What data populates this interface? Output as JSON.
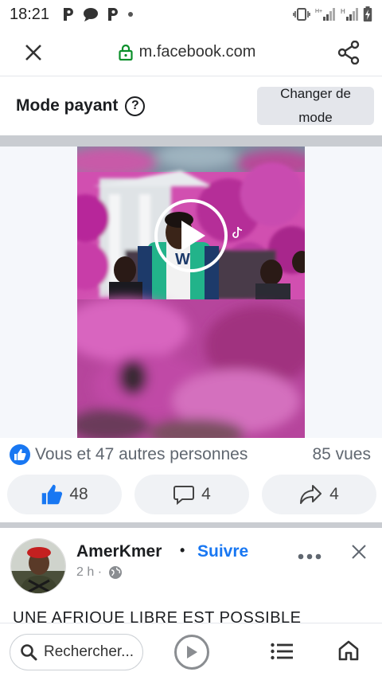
{
  "status_bar": {
    "time": "18:21",
    "network_label": "H"
  },
  "browser": {
    "url": "m.facebook.com"
  },
  "mode_bar": {
    "title": "Mode payant",
    "help_icon": "?",
    "change_button": "Changer de mode"
  },
  "video": {
    "play_icon": "play-icon",
    "overlay_letter": "W"
  },
  "reactions": {
    "summary": "Vous et 47 autres personnes",
    "views": "85 vues"
  },
  "actions": {
    "likes": "48",
    "comments": "4",
    "shares": "4"
  },
  "post": {
    "author": "AmerKmer",
    "dot": "•",
    "follow": "Suivre",
    "time": "2 h ·",
    "text": "UNE AFRIQUE LIBRE EST POSSIBLE"
  },
  "bottom_nav": {
    "search_placeholder": "Rechercher..."
  },
  "colors": {
    "accent": "#1877f2",
    "button_bg": "#f0f2f5",
    "separator": "#c9ccd1"
  }
}
